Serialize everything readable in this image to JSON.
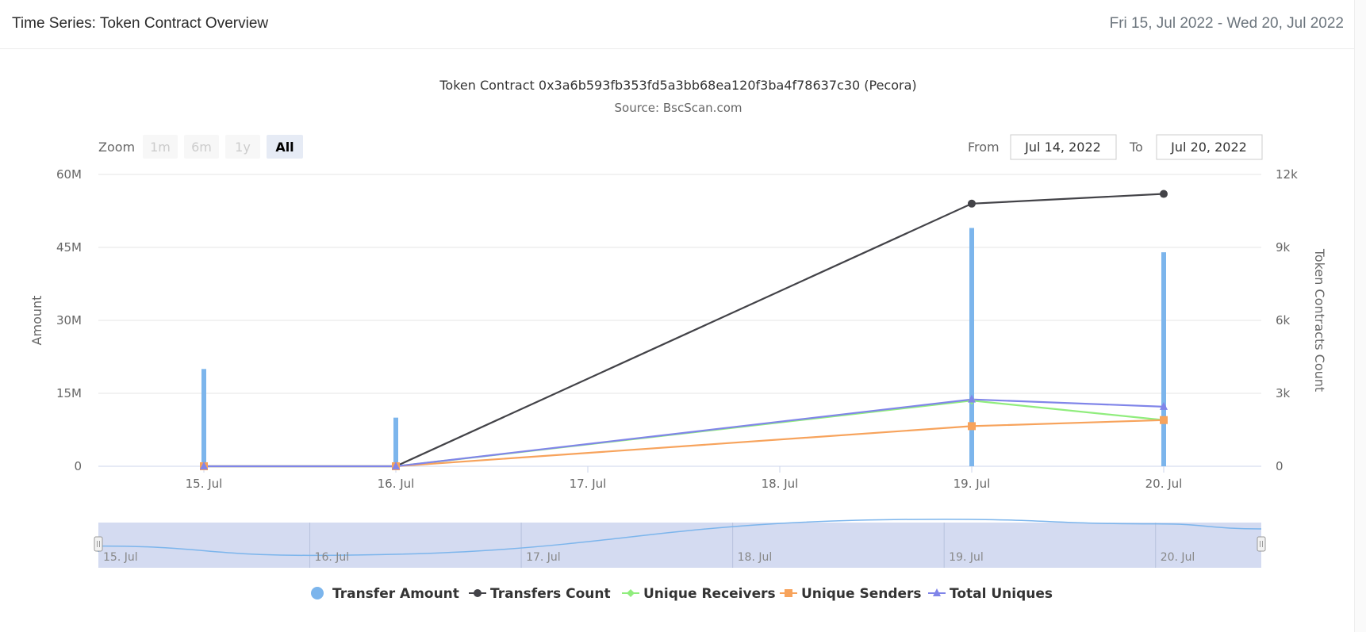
{
  "header": {
    "title": "Time Series: Token Contract Overview",
    "date_range": "Fri 15, Jul 2022 - Wed 20, Jul 2022"
  },
  "chart_data": {
    "type": "line",
    "title": "Token Contract 0x3a6b593fb353fd5a3bb68ea120f3ba4f78637c30 (Pecora)",
    "subtitle": "Source: BscScan.com",
    "x": [
      "15. Jul",
      "16. Jul",
      "17. Jul",
      "18. Jul",
      "19. Jul",
      "20. Jul"
    ],
    "x_values": [
      15,
      16,
      19,
      20
    ],
    "y_left": {
      "label": "Amount",
      "ticks": [
        "0",
        "15M",
        "30M",
        "45M",
        "60M"
      ],
      "range": [
        0,
        60000000
      ]
    },
    "y_right": {
      "label": "Token Contracts Count",
      "ticks": [
        "0",
        "3k",
        "6k",
        "9k",
        "12k"
      ],
      "range": [
        0,
        12000
      ]
    },
    "grid": true,
    "legend_position": "bottom",
    "series": [
      {
        "name": "Transfer Amount",
        "axis": "left",
        "kind": "column",
        "color": "#7cb5ec",
        "marker": "circle",
        "values": [
          20000000,
          10000000,
          49000000,
          44000000
        ]
      },
      {
        "name": "Transfers Count",
        "axis": "right",
        "kind": "line",
        "color": "#434348",
        "marker": "circle",
        "values": [
          0,
          0,
          10800,
          11200
        ]
      },
      {
        "name": "Unique Receivers",
        "axis": "right",
        "kind": "line",
        "color": "#90ed7d",
        "marker": "diamond",
        "values": [
          0,
          0,
          2700,
          1900
        ]
      },
      {
        "name": "Unique Senders",
        "axis": "right",
        "kind": "line",
        "color": "#f7a35c",
        "marker": "square",
        "values": [
          0,
          0,
          1650,
          1900
        ]
      },
      {
        "name": "Total Uniques",
        "axis": "right",
        "kind": "line",
        "color": "#8085e9",
        "marker": "triangle",
        "values": [
          0,
          0,
          2750,
          2450
        ]
      }
    ]
  },
  "range_selector": {
    "zoom_label": "Zoom",
    "buttons": [
      "1m",
      "6m",
      "1y",
      "All"
    ],
    "selected": "All",
    "from_label": "From",
    "from_value": "Jul 14, 2022",
    "to_label": "To",
    "to_value": "Jul 20, 2022"
  },
  "navigator": {
    "labels": [
      "15. Jul",
      "16. Jul",
      "17. Jul",
      "18. Jul",
      "19. Jul",
      "20. Jul"
    ]
  }
}
